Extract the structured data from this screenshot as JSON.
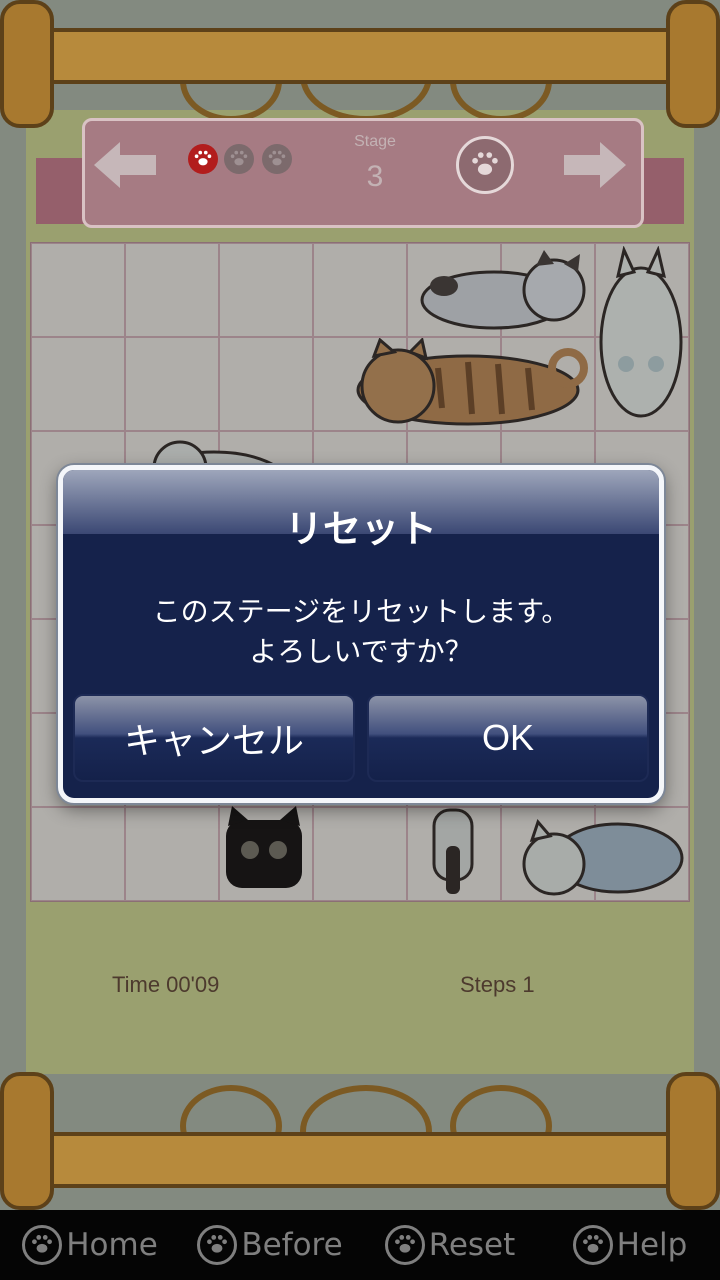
{
  "stage": {
    "label": "Stage",
    "number": "3",
    "progress_paws": [
      {
        "state": "active",
        "color": "#b21d1d"
      },
      {
        "state": "inactive",
        "color": "#7c6a6c"
      },
      {
        "state": "inactive",
        "color": "#7c6a6c"
      }
    ]
  },
  "status": {
    "time": "Time 00'09",
    "steps": "Steps 1"
  },
  "dialog": {
    "title": "リセット",
    "message_line1": "このステージをリセットします。",
    "message_line2": "よろしいですか？",
    "cancel_label": "キャンセル",
    "ok_label": "OK"
  },
  "toolbar": {
    "items": [
      {
        "label": "Home",
        "icon": "paw-icon"
      },
      {
        "label": "Before",
        "icon": "paw-icon"
      },
      {
        "label": "Reset",
        "icon": "paw-icon"
      },
      {
        "label": "Help",
        "icon": "paw-icon"
      }
    ]
  },
  "colors": {
    "dialog_background": "#15224b",
    "dialog_border": "#f4f6fa",
    "toolbar_background": "#050505",
    "toolbar_text": "#7f7f7f",
    "ribbon": "#a67b83"
  }
}
